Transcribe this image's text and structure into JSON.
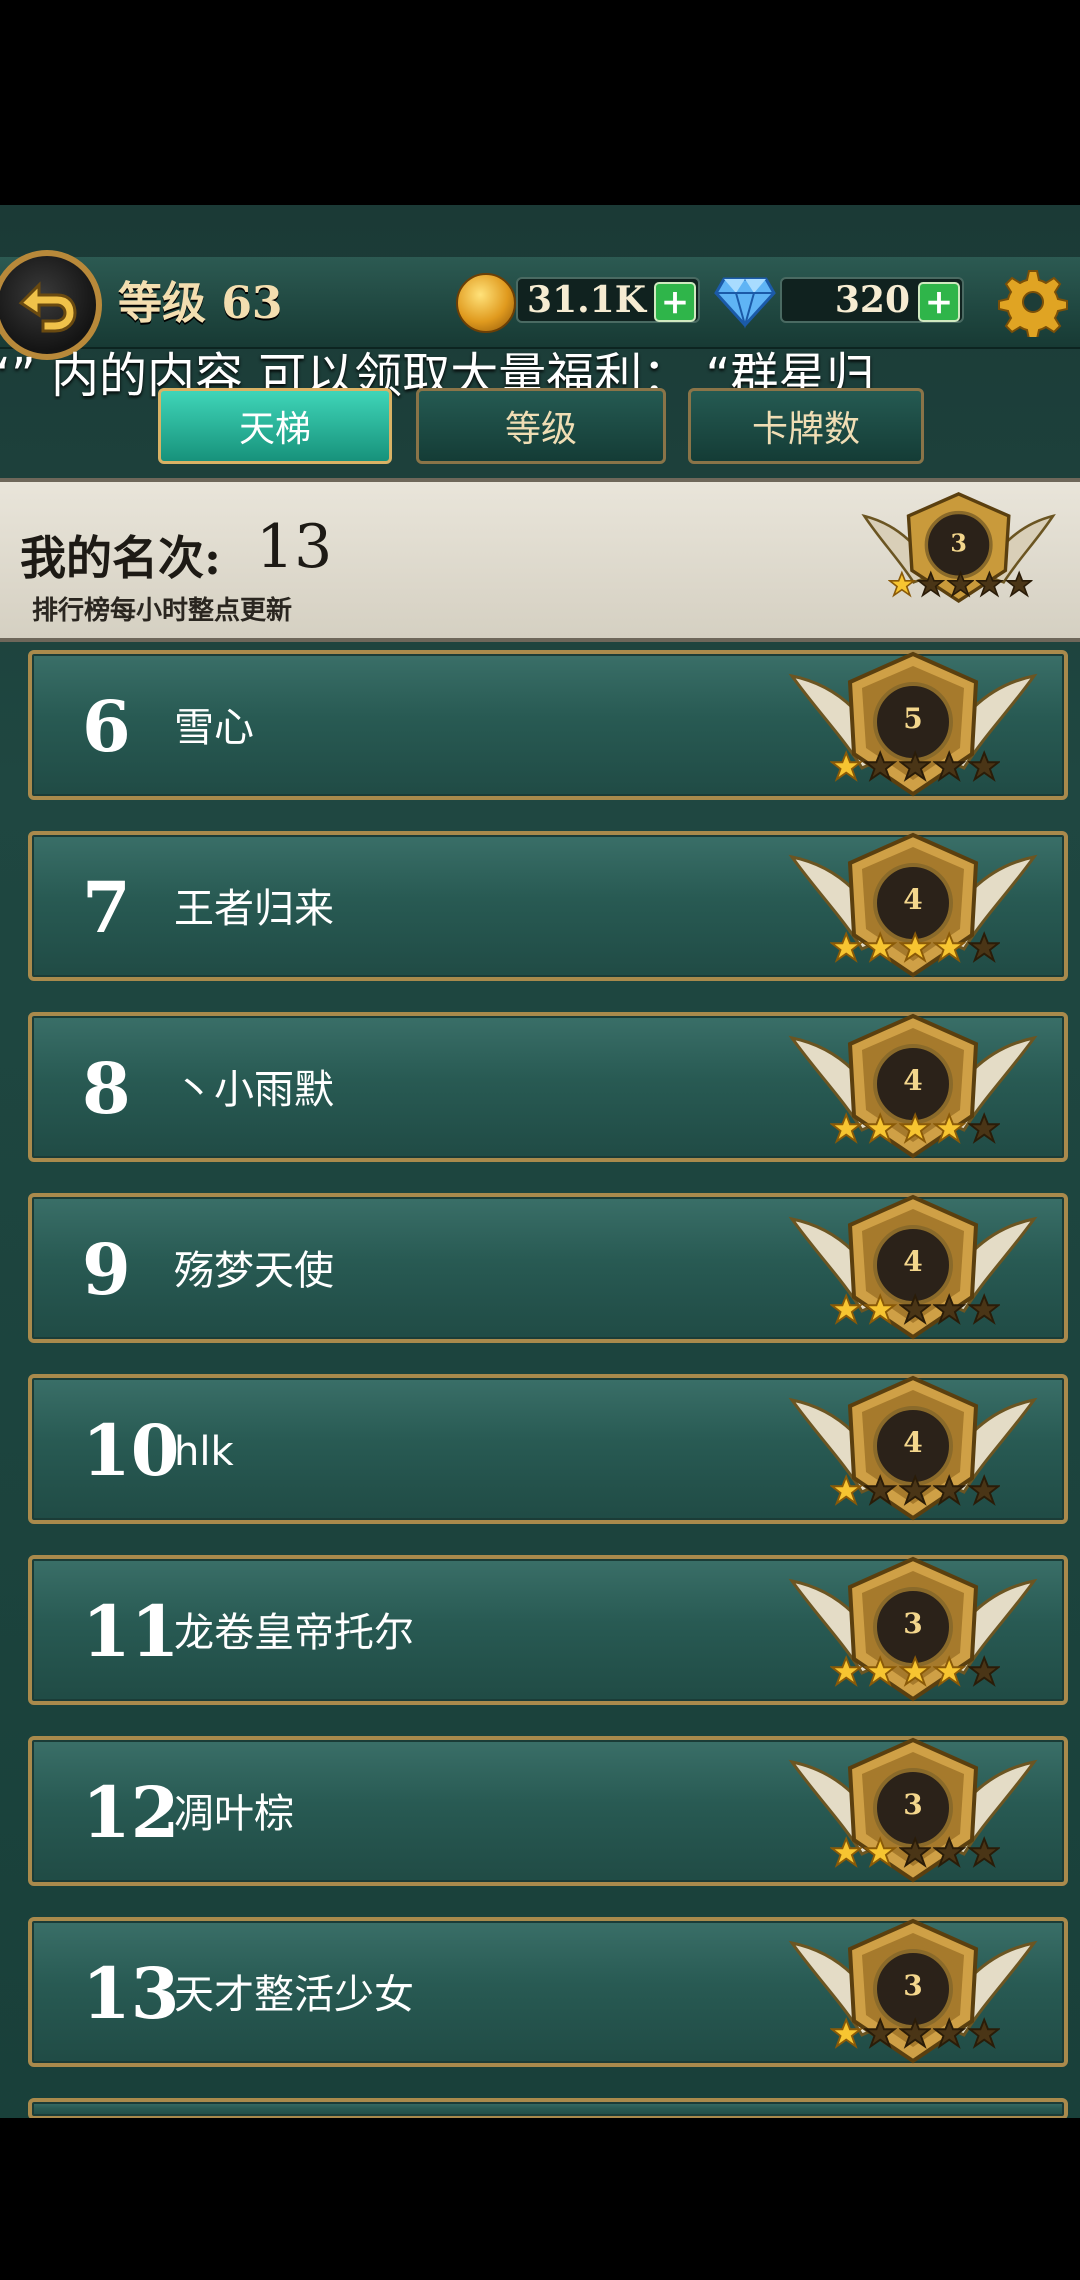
{
  "header": {
    "level_label": "等级 63",
    "coins": "31.1K",
    "gems": "320"
  },
  "ticker": "“”  内的内容 可以领取大量福利：  “群星归",
  "tabs": [
    {
      "label": "天梯",
      "active": true
    },
    {
      "label": "等级",
      "active": false
    },
    {
      "label": "卡牌数",
      "active": false
    }
  ],
  "my_rank": {
    "label": "我的名次:",
    "value": "13",
    "note": "排行榜每小时整点更新",
    "emblem_level": "3",
    "stars_filled": 1
  },
  "rows": [
    {
      "rank": "6",
      "name": "雪心",
      "emblem_level": "5",
      "stars_filled": 1
    },
    {
      "rank": "7",
      "name": "王者归来",
      "emblem_level": "4",
      "stars_filled": 4
    },
    {
      "rank": "8",
      "name": "丶小雨默",
      "emblem_level": "4",
      "stars_filled": 4
    },
    {
      "rank": "9",
      "name": "殇梦天使",
      "emblem_level": "4",
      "stars_filled": 2
    },
    {
      "rank": "10",
      "name": "hlk",
      "emblem_level": "4",
      "stars_filled": 1
    },
    {
      "rank": "11",
      "name": "龙卷皇帝托尔",
      "emblem_level": "3",
      "stars_filled": 4
    },
    {
      "rank": "12",
      "name": "凋叶棕",
      "emblem_level": "3",
      "stars_filled": 2
    },
    {
      "rank": "13",
      "name": "天才整活少女",
      "emblem_level": "3",
      "stars_filled": 1
    }
  ],
  "icons": {
    "back": "back-arrow-icon",
    "coin": "coin-icon",
    "gem": "diamond-icon",
    "settings": "gear-icon",
    "rank_emblem": "winged-shield-emblem-icon",
    "star": "star-icon"
  },
  "colors": {
    "background": "#1f4741",
    "gold_border": "#a98a4c",
    "active_tab": "#2fc7a8",
    "plus_green": "#2fb54a"
  }
}
